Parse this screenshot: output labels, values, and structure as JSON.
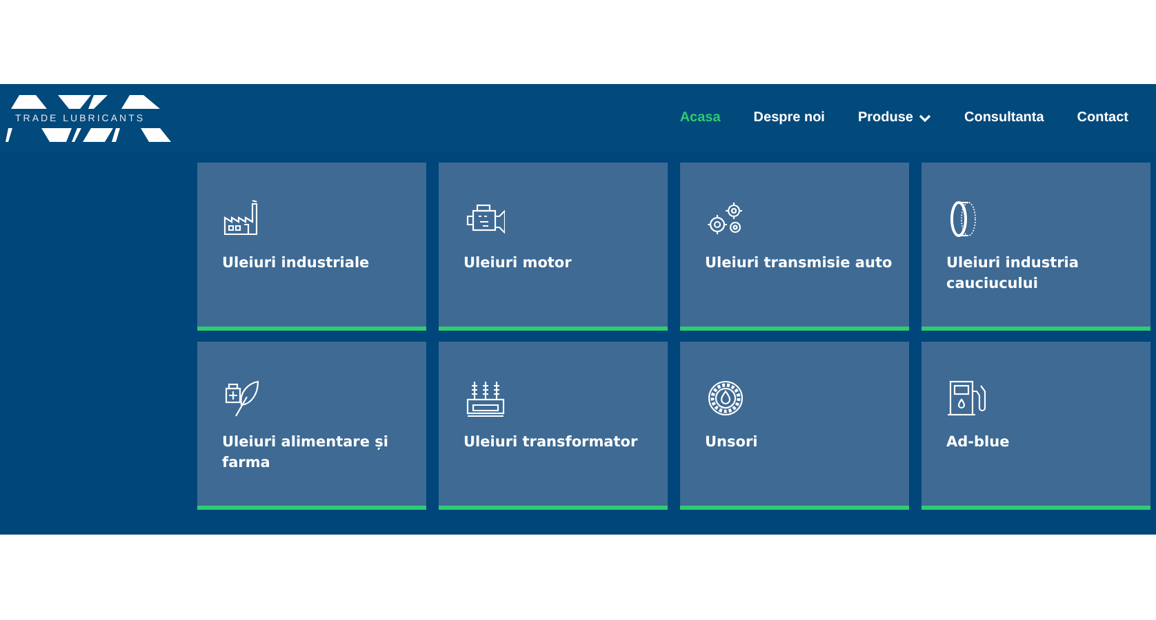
{
  "logo": {
    "tagline": "TRADE LUBRICANTS"
  },
  "nav": [
    {
      "label": "Acasa",
      "selected": true,
      "dropdown": false
    },
    {
      "label": "Despre noi",
      "selected": false,
      "dropdown": false
    },
    {
      "label": "Produse",
      "selected": false,
      "dropdown": true
    },
    {
      "label": "Consultanta",
      "selected": false,
      "dropdown": false
    },
    {
      "label": "Contact",
      "selected": false,
      "dropdown": false
    }
  ],
  "categories": [
    {
      "kind": "factory",
      "label": "Uleiuri industriale"
    },
    {
      "kind": "engine",
      "label": "Uleiuri motor"
    },
    {
      "kind": "gears",
      "label": "Uleiuri transmisie auto"
    },
    {
      "kind": "tire",
      "label": "Uleiuri industria cauciucului"
    },
    {
      "kind": "leaf",
      "label": "Uleiuri alimentare și farma"
    },
    {
      "kind": "transformer",
      "label": "Uleiuri transformator"
    },
    {
      "kind": "bearing",
      "label": "Unsori"
    },
    {
      "kind": "pump",
      "label": "Ad-blue"
    }
  ]
}
